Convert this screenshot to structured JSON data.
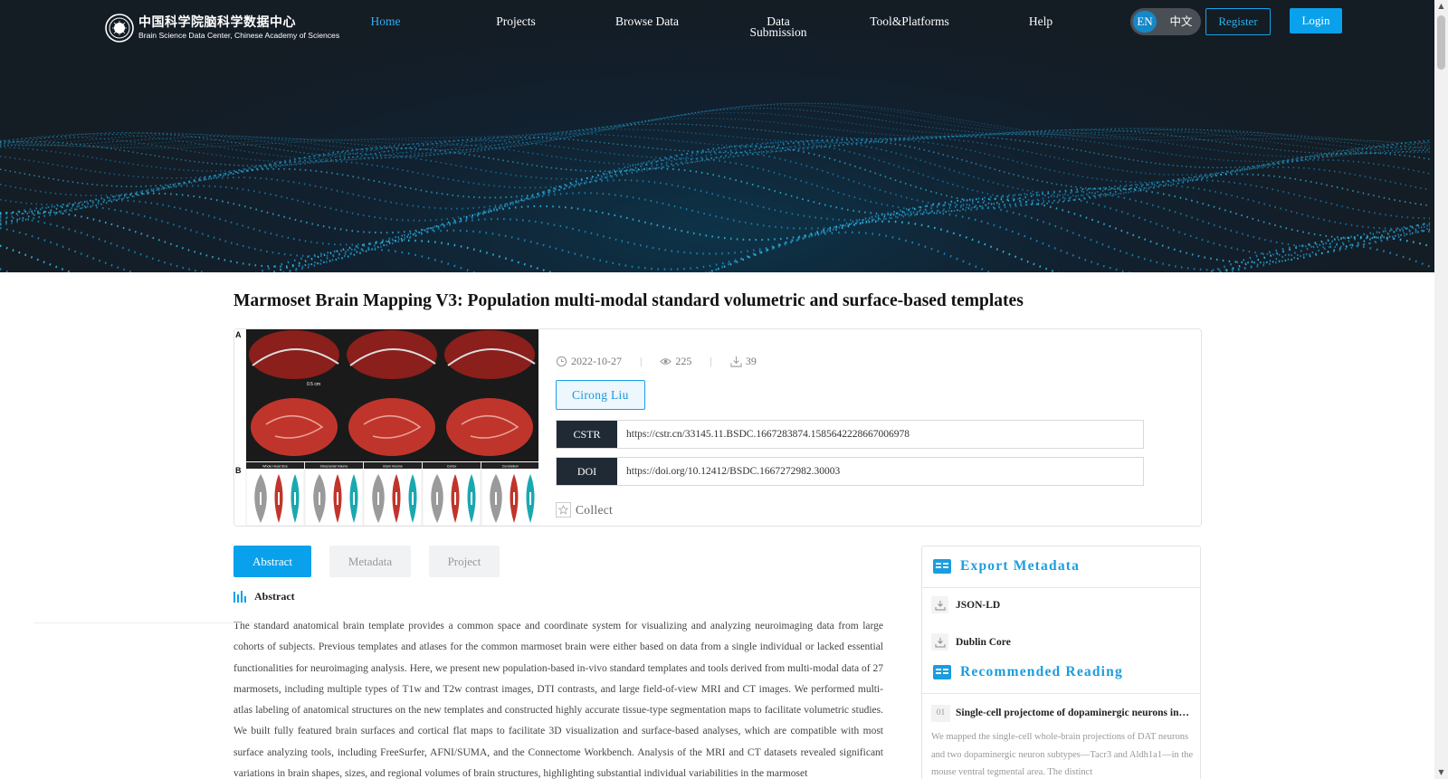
{
  "header": {
    "logo": {
      "cn": "中国科学院脑科学数据中心",
      "en": "Brain Science Data Center, Chinese Academy of Sciences"
    },
    "nav": {
      "home": "Home",
      "projects": "Projects",
      "browse": "Browse Data",
      "submission_line1": "Data",
      "submission_line2": "Submission",
      "tools": "Tool&Platforms",
      "help": "Help"
    },
    "lang": {
      "en": "EN",
      "cn": "中文"
    },
    "register": "Register",
    "login": "Login"
  },
  "dataset": {
    "title": "Marmoset Brain Mapping V3: Population multi-modal standard volumetric and surface-based templates",
    "date": "2022-10-27",
    "views": "225",
    "downloads": "39",
    "author": "Cirong Liu",
    "cstr_label": "CSTR",
    "cstr": "https://cstr.cn/33145.11.BSDC.1667283874.1585642228667006978",
    "doi_label": "DOI",
    "doi": "https://doi.org/10.12412/BSDC.1667272982.30003",
    "collect": "Collect"
  },
  "figure": {
    "panel_a": "A",
    "panel_b": "B",
    "scale_bar": "0.5 cm",
    "violin_titles": [
      "Whole Head Size",
      "Intracranial Volume",
      "Brain Volume",
      "Cortex",
      "Cerebellum"
    ]
  },
  "tabs": {
    "abstract": "Abstract",
    "metadata": "Metadata",
    "project": "Project"
  },
  "abstract": {
    "heading": "Abstract",
    "text": "The standard anatomical brain template provides a common space and coordinate system for visualizing and analyzing neuroimaging data from large cohorts of subjects. Previous templates and atlases for the common marmoset brain were either based on data from a single individual or lacked essential functionalities for neuroimaging analysis. Here, we present new population-based in-vivo standard templates and tools derived from multi-modal data of 27 marmosets, including multiple types of T1w and T2w contrast images, DTI contrasts, and large field-of-view MRI and CT images. We performed multi-atlas labeling of anatomical structures on the new templates and constructed highly accurate tissue-type segmentation maps to facilitate volumetric studies. We built fully featured brain surfaces and cortical flat maps to facilitate 3D visualization and surface-based analyses, which are compatible with most surface analyzing tools, including FreeSurfer, AFNI/SUMA, and the Connectome Workbench. Analysis of the MRI and CT datasets revealed significant variations in brain shapes, sizes, and regional volumes of brain structures, highlighting substantial individual variabilities in the marmoset"
  },
  "sidebar": {
    "export_title": "Export Metadata",
    "export_items": [
      "JSON-LD",
      "Dublin Core"
    ],
    "recommended_title": "Recommended Reading",
    "recommended": [
      {
        "num": "01",
        "title": "Single-cell projectome of dopaminergic neurons in the mouse ventral tegmental area",
        "text": "We mapped the single-cell whole-brain projections of DAT neurons and two dopaminergic neuron subtypes—Tacr3 and Aldh1a1—in the mouse ventral tegmental area. The distinct"
      }
    ]
  },
  "colors": {
    "accent": "#0aa1ec",
    "hero_bg": "#141c24",
    "label_bg": "#1f2a35",
    "tissue_red": "#c0352b",
    "violin_teal": "#1aa8b0"
  }
}
